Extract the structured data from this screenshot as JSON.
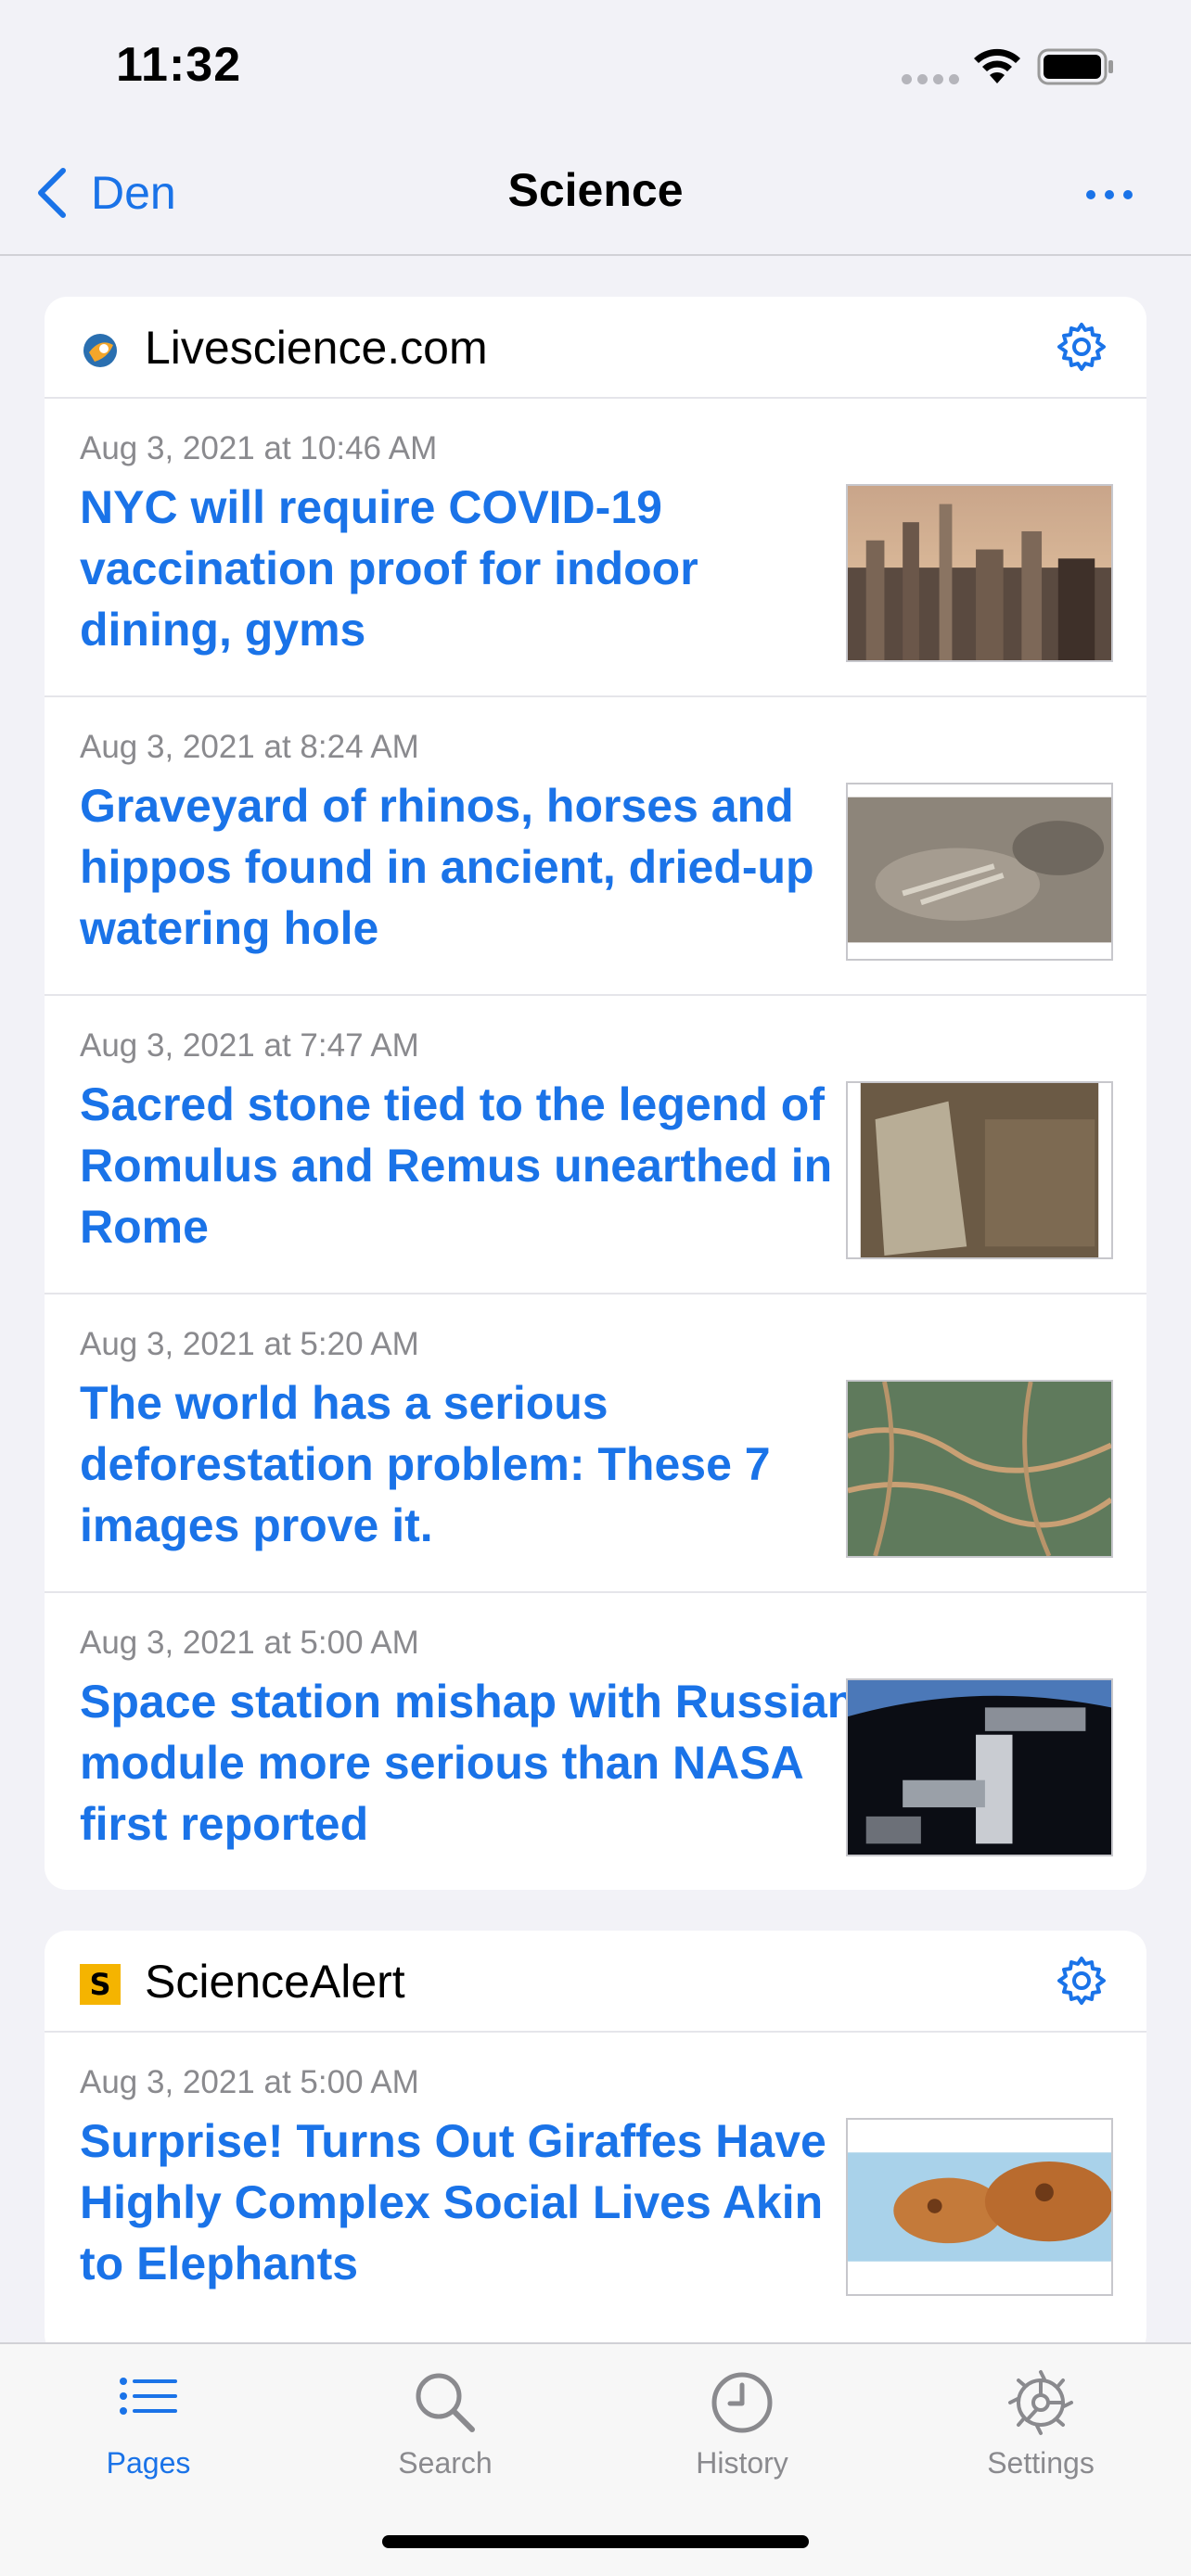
{
  "status_bar": {
    "time": "11:32"
  },
  "nav": {
    "back_label": "Den",
    "title": "Science",
    "more_icon": "ellipsis-icon"
  },
  "sections": [
    {
      "source": "Livescience.com",
      "articles": [
        {
          "date": "Aug 3, 2021 at 10:46 AM",
          "title": "NYC will require COVID-19 vaccination proof for indoor dining, gyms"
        },
        {
          "date": "Aug 3, 2021 at 8:24 AM",
          "title": "Graveyard of rhinos, horses and hippos found in ancient, dried-up watering hole"
        },
        {
          "date": "Aug 3, 2021 at 7:47 AM",
          "title": "Sacred stone tied to the legend of Romulus and Remus unearthed in Rome"
        },
        {
          "date": "Aug 3, 2021 at 5:20 AM",
          "title": "The world has a serious deforestation problem: These 7 images prove it."
        },
        {
          "date": "Aug 3, 2021 at 5:00 AM",
          "title": "Space station mishap with Russian module more serious than NASA first reported"
        }
      ]
    },
    {
      "source": "ScienceAlert",
      "articles": [
        {
          "date": "Aug 3, 2021 at 5:00 AM",
          "title": "Surprise! Turns Out Giraffes Have Highly Complex Social Lives Akin to Elephants"
        }
      ]
    }
  ],
  "tabs": [
    {
      "label": "Pages",
      "icon": "list-icon",
      "active": true
    },
    {
      "label": "Search",
      "icon": "search-icon",
      "active": false
    },
    {
      "label": "History",
      "icon": "clock-icon",
      "active": false
    },
    {
      "label": "Settings",
      "icon": "gear-icon",
      "active": false
    }
  ],
  "colors": {
    "accent": "#1a73e8",
    "background": "#f2f2f7",
    "secondary_text": "#8a8a8e"
  }
}
